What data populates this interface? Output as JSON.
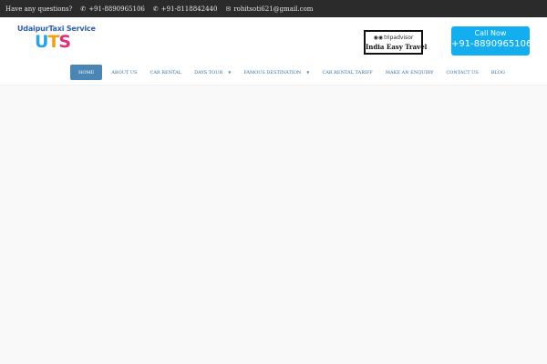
{
  "topbar": {
    "question": "Have any questions?",
    "phone_icon": "phone-icon",
    "phone1": "+91-8890965106",
    "phone2": "+91-8118842440",
    "mail_icon": "envelope-icon",
    "email": "rohitsoti621@gmail.com"
  },
  "logo": {
    "title": "UdaipurTaxi Service",
    "mark_u": "U",
    "mark_t": "T",
    "mark_s": "S"
  },
  "tripadvisor": {
    "brand": "tripadvisor",
    "icon": "owl-icon",
    "name": "India Easy Travel"
  },
  "callnow": {
    "label": "Call Now",
    "number": "+91-8890965106"
  },
  "nav": {
    "items": [
      {
        "label": "HOME"
      },
      {
        "label": "ABOUT US"
      },
      {
        "label": "CAR RENTAL"
      },
      {
        "label": "DAYS TOUR"
      },
      {
        "label": "FAMOUS DESTINATION"
      },
      {
        "label": "CAR RENTAL TARIFF"
      },
      {
        "label": "MAKE AN ENQUIRY"
      },
      {
        "label": "CONTACT US"
      },
      {
        "label": "BLOG"
      }
    ],
    "dropdown_icon": "chevron-down-icon"
  },
  "colors": {
    "topbar_bg": "#2b2b2b",
    "nav_active_bg": "#4a86b5",
    "nav_text": "#2b6fa6",
    "callnow_bg": "#13aef0"
  }
}
